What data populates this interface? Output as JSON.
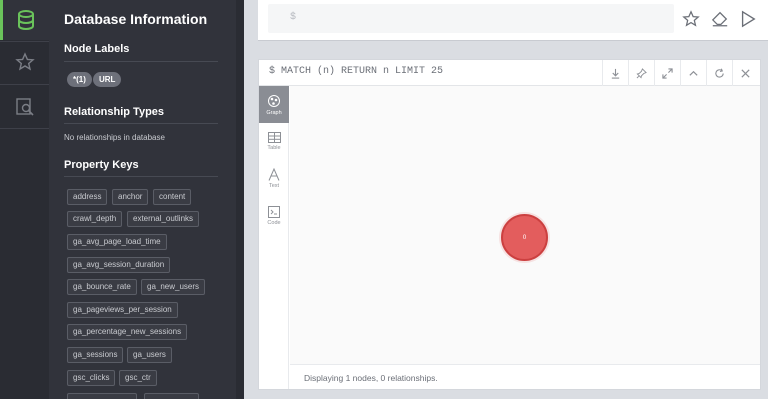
{
  "drawer": {
    "title": "Database Information",
    "node_labels_heading": "Node Labels",
    "node_labels": [
      "*(1)",
      "URL"
    ],
    "relationship_types_heading": "Relationship Types",
    "no_relationships": "No relationships in database",
    "property_keys_heading": "Property Keys",
    "property_keys": [
      "address",
      "anchor",
      "content",
      "crawl_depth",
      "external_outlinks",
      "ga_avg_page_load_time",
      "ga_avg_session_duration",
      "ga_bounce_rate",
      "ga_new_users",
      "ga_pageviews_per_session",
      "ga_percentage_new_sessions",
      "ga_sessions",
      "ga_users",
      "gsc_clicks",
      "gsc_ctr"
    ]
  },
  "editor": {
    "prompt": "$"
  },
  "frame": {
    "command": "$ MATCH (n) RETURN n LIMIT 25",
    "tabs": [
      "Graph",
      "Table",
      "Text",
      "Code"
    ],
    "node_caption": "0",
    "status": "Displaying 1 nodes, 0 relationships."
  },
  "colors": {
    "accent_green": "#6ac35b",
    "node_fill": "#e35d5d",
    "drawer_bg": "#31333b"
  },
  "icons": {
    "rail": [
      "database-icon",
      "star-icon",
      "search-icon"
    ],
    "editor": [
      "favorite-star-icon",
      "eraser-icon",
      "play-icon"
    ],
    "frame": [
      "download-icon",
      "pin-icon",
      "expand-icon",
      "collapse-icon",
      "rerun-icon",
      "close-icon"
    ]
  }
}
